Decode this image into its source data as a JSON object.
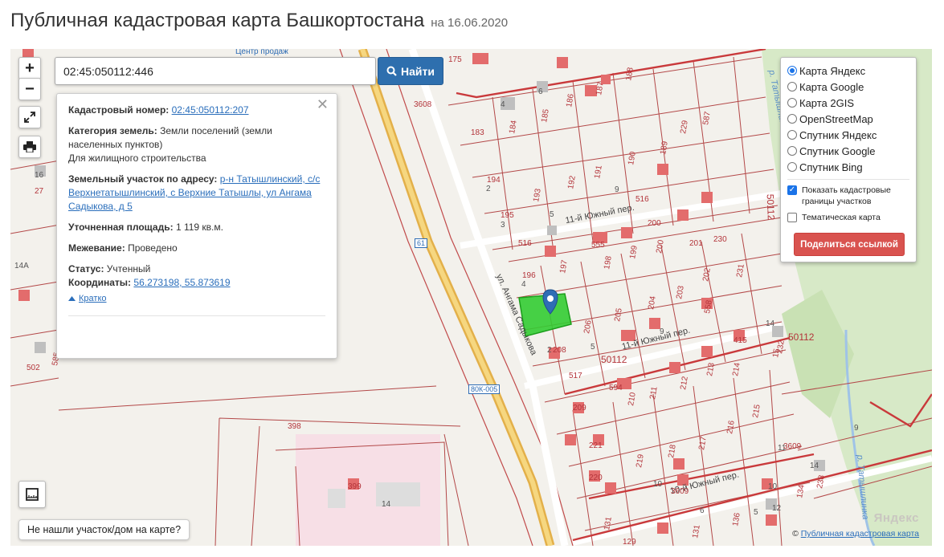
{
  "header": {
    "title": "Публичная кадастровая карта Башкортостана",
    "date": "на 16.06.2020"
  },
  "search": {
    "value": "02:45:050112:446",
    "button_label": "Найти"
  },
  "zoom": {
    "in_label": "+",
    "out_label": "−"
  },
  "info": {
    "cadastral_label": "Кадастровый номер:",
    "cadastral_value": "02:45:050112:207",
    "category_label": "Категория земель:",
    "category_value": "Земли поселений (земли населенных пунктов)",
    "category_use": "Для жилищного строительства",
    "address_label": "Земельный участок по адресу:",
    "address_value": "р-н Татышлинский, с/с Верхнетатышлинский, с Верхние Татышлы, ул Ангама Садыкова, д 5",
    "area_label": "Уточненная площадь:",
    "area_value": "1 119 кв.м.",
    "survey_label": "Межевание:",
    "survey_value": "Проведено",
    "status_label": "Статус:",
    "status_value": "Учтенный",
    "coords_label": "Координаты:",
    "coords_value": "56.273198, 55.873619",
    "brief_label": "Кратко"
  },
  "layers": {
    "options": [
      "Карта Яндекс",
      "Карта Google",
      "Карта 2GIS",
      "OpenStreetMap",
      "Спутник Яндекс",
      "Спутник Google",
      "Спутник Bing"
    ],
    "selected_index": 0,
    "show_borders_label": "Показать кадастровые границы участков",
    "show_borders_checked": true,
    "thematic_label": "Тематическая карта",
    "thematic_checked": false,
    "share_label": "Поделиться ссылкой"
  },
  "map": {
    "street_labels": [
      "ул. Ангама Садыкова",
      "11-й Южный пер.",
      "11-й Южный пер.",
      "10-й Южный пер.",
      "р. Татышлинка",
      "р. Татышлинка"
    ],
    "road_signs": [
      "80К-005",
      "61"
    ],
    "top_label": "Центр продаж",
    "quarter_labels": [
      "50112",
      "50112",
      "50112",
      "3608",
      "3609",
      "3609"
    ],
    "parcels": [
      "175",
      "186",
      "187",
      "188",
      "183",
      "184",
      "185",
      "229",
      "587",
      "190",
      "189",
      "194",
      "193",
      "192",
      "191",
      "195",
      "516",
      "516",
      "200",
      "201",
      "230",
      "196",
      "197",
      "555",
      "198",
      "199",
      "202",
      "203",
      "231",
      "206",
      "205",
      "204",
      "558",
      "208",
      "232",
      "213",
      "214",
      "415",
      "594",
      "210",
      "211",
      "212",
      "209",
      "215",
      "216",
      "221",
      "219",
      "217",
      "218",
      "220",
      "238",
      "3",
      "4",
      "5",
      "6",
      "9",
      "10",
      "11",
      "12",
      "13",
      "14",
      "15",
      "16",
      "27",
      "14А",
      "502",
      "585",
      "398",
      "399",
      "131",
      "129",
      "134",
      "517",
      "136"
    ],
    "not_found_label": "Не нашли участок/дом на карте?",
    "attribution_prefix": "© ",
    "attribution_link": "Публичная кадастровая карта",
    "provider_logo": "Яндекс"
  }
}
